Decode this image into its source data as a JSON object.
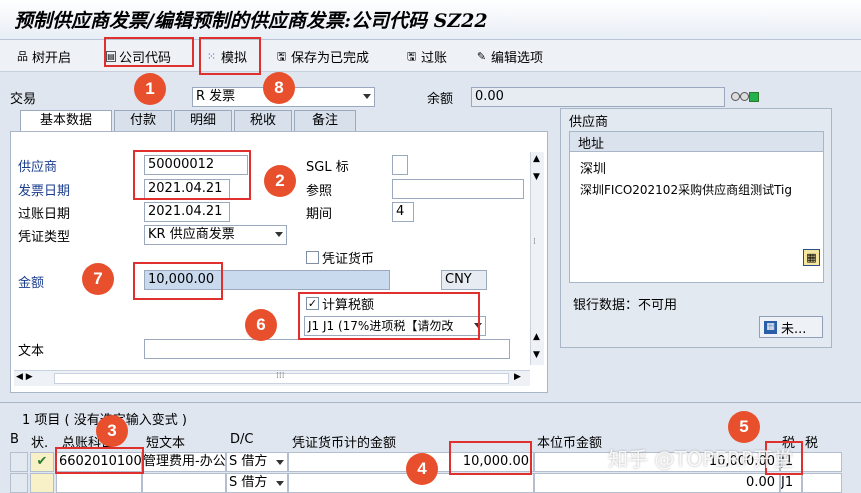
{
  "title": "预制供应商发票/编辑预制的供应商发票:公司代码 SZ22",
  "toolbar": {
    "tree_open": "树开启",
    "company_code": "公司代码",
    "simulate": "模拟",
    "save_complete": "保存为已完成",
    "post": "过账",
    "edit_options": "编辑选项"
  },
  "header": {
    "transaction_label": "交易",
    "transaction_value": "R 发票",
    "balance_label": "余额",
    "balance_value": "0.00"
  },
  "tabs": [
    "基本数据",
    "付款",
    "明细",
    "税收",
    "备注"
  ],
  "basic": {
    "vendor_label": "供应商",
    "vendor_value": "50000012",
    "invoice_date_label": "发票日期",
    "invoice_date_value": "2021.04.21",
    "posting_date_label": "过账日期",
    "posting_date_value": "2021.04.21",
    "doc_type_label": "凭证类型",
    "doc_type_value": "KR 供应商发票",
    "sgl_label": "SGL 标",
    "reference_label": "参照",
    "period_label": "期间",
    "period_value": "4",
    "doc_currency_label": "凭证货币",
    "amount_label": "金额",
    "amount_value": "10,000.00",
    "currency": "CNY",
    "calc_tax_label": "计算税额",
    "tax_code_value": "J1 J1 (17%进项税【请勿改",
    "text_label": "文本"
  },
  "vendor_panel": {
    "title": "供应商",
    "address_header": "地址",
    "city": "深圳",
    "name": "深圳FICO202102采购供应商组测试Tig",
    "bank_data": "银行数据：不可用",
    "more_button": "未..."
  },
  "items": {
    "summary": "1 项目 ( 没有选定输入变式 )",
    "columns": {
      "status": "状.",
      "gl_account": "总账科目",
      "short_text": "短文本",
      "dc": "D/C",
      "doc_amount": "凭证货币计的金额",
      "local_amount": "本位币金额",
      "tax_code": "税",
      "tax_jur": "税"
    },
    "row_marker_header": "B",
    "rows": [
      {
        "gl_account": "6602010100",
        "short_text": "管理费用-办公",
        "dc_code": "S",
        "dc_text": "借方",
        "doc_amount": "10,000.00",
        "local_amount": "10,000.00",
        "tax": "J1"
      },
      {
        "gl_account": "",
        "short_text": "",
        "dc_code": "S",
        "dc_text": "借方",
        "doc_amount": "",
        "local_amount": "0.00",
        "tax": "J1"
      }
    ]
  },
  "badges": [
    "1",
    "8",
    "2",
    "7",
    "6",
    "3",
    "4",
    "5"
  ],
  "watermark": "知乎 @TOPERP开堂"
}
